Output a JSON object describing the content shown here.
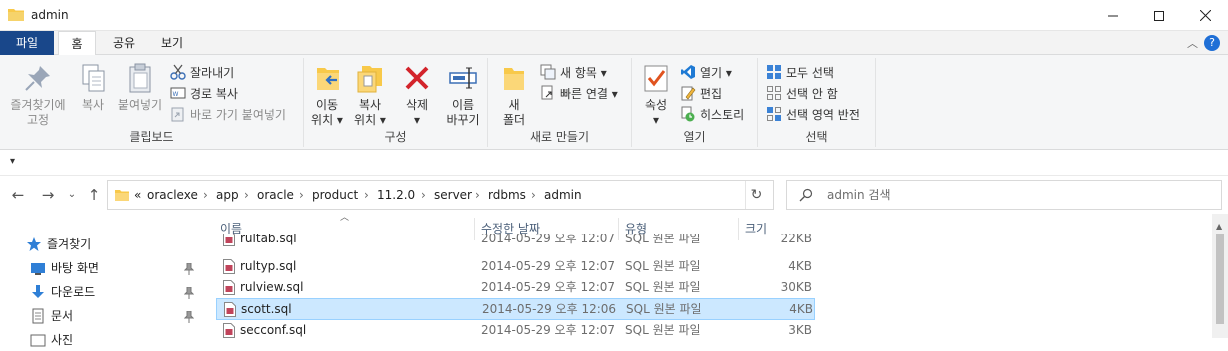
{
  "window": {
    "title": "admin",
    "minimize_icon": "minimize-icon",
    "maximize_icon": "maximize-icon",
    "close_icon": "close-icon"
  },
  "tabs": {
    "file": "파일",
    "home": "홈",
    "share": "공유",
    "view": "보기"
  },
  "ribbon": {
    "clipboard": {
      "label": "클립보드",
      "pin_quick_access": [
        "즐겨찾기에",
        "고정"
      ],
      "copy": "복사",
      "paste": "붙여넣기",
      "cut": "잘라내기",
      "copy_path": "경로 복사",
      "paste_shortcut": "바로 가기 붙여넣기"
    },
    "organize": {
      "label": "구성",
      "move_to": [
        "이동",
        "위치 ▾"
      ],
      "copy_to": [
        "복사",
        "위치 ▾"
      ],
      "delete": [
        "삭제",
        "▾"
      ],
      "rename": [
        "이름",
        "바꾸기"
      ]
    },
    "new": {
      "label": "새로 만들기",
      "new_folder": [
        "새",
        "폴더"
      ],
      "new_item": "새 항목 ▾",
      "easy_access": "빠른 연결 ▾"
    },
    "open": {
      "label": "열기",
      "properties": [
        "속성",
        "▾"
      ],
      "open": "열기 ▾",
      "edit": "편집",
      "history": "히스토리"
    },
    "select": {
      "label": "선택",
      "select_all": "모두 선택",
      "select_none": "선택 안 함",
      "invert": "선택 영역 반전"
    }
  },
  "address": {
    "overflow": "«",
    "crumbs": [
      "oraclexe",
      "app",
      "oracle",
      "product",
      "11.2.0",
      "server",
      "rdbms",
      "admin"
    ],
    "separator": "›",
    "search_placeholder": "admin 검색"
  },
  "nav": {
    "items": [
      "즐겨찾기",
      "바탕 화면",
      "다운로드",
      "문서",
      "사진"
    ]
  },
  "columns": {
    "name": "이름",
    "date": "수정한 날짜",
    "type": "유형",
    "size": "크기"
  },
  "files": [
    {
      "name": "rultab.sql",
      "date": "2014-05-29 오후 12:07",
      "type": "SQL 원본 파일",
      "size": "22KB"
    },
    {
      "name": "rultyp.sql",
      "date": "2014-05-29 오후 12:07",
      "type": "SQL 원본 파일",
      "size": "4KB"
    },
    {
      "name": "rulview.sql",
      "date": "2014-05-29 오후 12:07",
      "type": "SQL 원본 파일",
      "size": "30KB"
    },
    {
      "name": "scott.sql",
      "date": "2014-05-29 오후 12:06",
      "type": "SQL 원본 파일",
      "size": "4KB"
    },
    {
      "name": "secconf.sql",
      "date": "2014-05-29 오후 12:07",
      "type": "SQL 원본 파일",
      "size": "3KB"
    }
  ],
  "selected_file": "scott.sql",
  "colors": {
    "file_tab": "#19478a",
    "selection": "#cce8ff",
    "selection_border": "#99d1ff",
    "folder": "#f8c94a"
  }
}
